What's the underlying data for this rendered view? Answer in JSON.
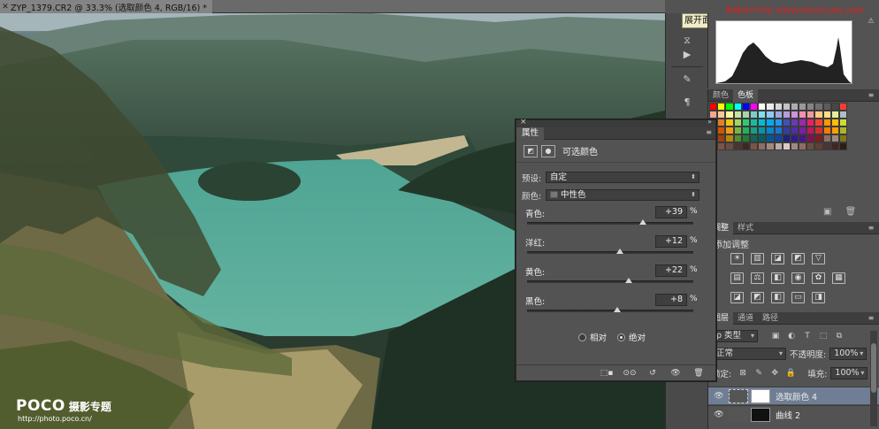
{
  "document": {
    "tab_title": "ZYP_1379.CR2 @ 33.3% (选取颜色 4, RGB/16) *"
  },
  "tooltip": "展开面板",
  "brandmark": "思缘设计论坛 WWW.MISSYUAN.COM",
  "watermark": {
    "logo": "POCO",
    "title": "摄影专题",
    "url": "http://photo.poco.cn/"
  },
  "swatches": {
    "tabs": [
      "颜色",
      "色板"
    ],
    "active_tab": "色板",
    "colors": [
      "#ff0000",
      "#ffff00",
      "#00ff00",
      "#00ffff",
      "#0000ff",
      "#ff00ff",
      "#ffffff",
      "#ebebeb",
      "#d6d6d6",
      "#c2c2c2",
      "#adadad",
      "#999999",
      "#858585",
      "#707070",
      "#5c5c5c",
      "#474747",
      "#ff3b30",
      "#f9a58c",
      "#f7c99b",
      "#fff59d",
      "#c5e1a5",
      "#a5d6a7",
      "#80cbc4",
      "#80deea",
      "#90caf9",
      "#9fa8da",
      "#b39ddb",
      "#ce93d8",
      "#f48fb1",
      "#ef9a9a",
      "#ffcc80",
      "#ffe082",
      "#e6ee9c",
      "#b0bec5",
      "#e74c3c",
      "#e67e22",
      "#f1c40f",
      "#a3d65c",
      "#2ecc71",
      "#1abc9c",
      "#00bcd4",
      "#03a9f4",
      "#2196f3",
      "#3f51b5",
      "#673ab7",
      "#9c27b0",
      "#e91e63",
      "#f44336",
      "#ff9800",
      "#ffc107",
      "#cddc39",
      "#c0392b",
      "#d35400",
      "#f39c12",
      "#7cb342",
      "#27ae60",
      "#16a085",
      "#0097a7",
      "#0288d1",
      "#1976d2",
      "#303f9f",
      "#512da8",
      "#7b1fa2",
      "#c2185b",
      "#d32f2f",
      "#f57c00",
      "#ffa000",
      "#afb42b",
      "#8e1b12",
      "#a0400a",
      "#b8860b",
      "#558b2f",
      "#1e7e34",
      "#0e6655",
      "#006064",
      "#01579b",
      "#0d47a1",
      "#1a237e",
      "#311b92",
      "#4a148c",
      "#880e4f",
      "#7f1d1d",
      "#8d6e63",
      "#a1887f",
      "#827717",
      "#5d4037",
      "#795548",
      "#6d4c41",
      "#4e342e",
      "#3e2723",
      "#795548",
      "#8d6e63",
      "#a1887f",
      "#bcaaa4",
      "#d7ccc8",
      "#a1887f",
      "#8d6e63",
      "#6d4c41",
      "#5d4037",
      "#4e342e",
      "#3e2723",
      "#2e1d17"
    ]
  },
  "adjustments": {
    "tabs": [
      "调整",
      "样式"
    ],
    "active_tab": "调整",
    "heading": "添加调整",
    "row1_icons": [
      "brightness-icon",
      "levels-icon",
      "curves-icon",
      "exposure-icon",
      "vibrance-icon"
    ],
    "row2_icons": [
      "hue-saturation-icon",
      "color-balance-icon",
      "black-white-icon",
      "photo-filter-icon",
      "channel-mixer-icon",
      "color-lookup-icon"
    ],
    "row3_icons": [
      "invert-icon",
      "posterize-icon",
      "threshold-icon",
      "gradient-map-icon",
      "selective-color-icon"
    ]
  },
  "layers": {
    "tabs": [
      "图层",
      "通道",
      "路径"
    ],
    "active_tab": "图层",
    "filter_kind": "ρ 类型",
    "blend_mode": "正常",
    "opacity_label": "不透明度:",
    "opacity_value": "100%",
    "lock_label": "锁定:",
    "fill_label": "填充:",
    "fill_value": "100%",
    "items": [
      {
        "name": "选取颜色 4",
        "active": true
      },
      {
        "name": "曲线 2",
        "active": false
      }
    ]
  },
  "properties": {
    "tab": "属性",
    "title": "可选颜色",
    "preset_label": "预设:",
    "preset_value": "自定",
    "colors_label": "颜色:",
    "colors_value": "中性色",
    "sliders": [
      {
        "label": "青色:",
        "value": "+39",
        "fraction": 0.695
      },
      {
        "label": "洋红:",
        "value": "+12",
        "fraction": 0.56
      },
      {
        "label": "黄色:",
        "value": "+22",
        "fraction": 0.61
      },
      {
        "label": "黑色:",
        "value": "+8",
        "fraction": 0.54
      }
    ],
    "percent": "%",
    "method_relative": "相对",
    "method_absolute": "绝对",
    "method_selected": "绝对"
  },
  "colors": {
    "active_layer": "#6f7e94",
    "panel_bg": "#535353",
    "tooltip_bg": "#f1eec8",
    "brandmark": "#e21d1d"
  }
}
